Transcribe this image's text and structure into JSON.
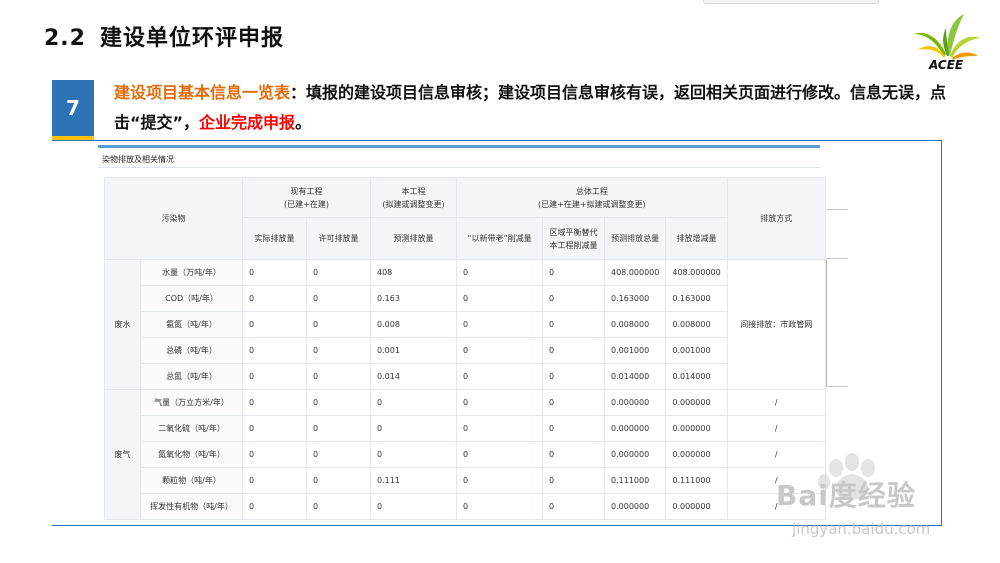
{
  "slide": {
    "section_number": "2.2",
    "title": "建设单位环评申报",
    "logo_text": "ACEE",
    "step_number": "7",
    "desc": {
      "part1": "建设项目基本信息一览表",
      "part2": "：填报的建设项目信息审核；建设项目信息审核有误，返回相关页面进行修改。信息无误，点击“提交”，",
      "part3": "企业完成申报",
      "part4": "。"
    }
  },
  "screenshot": {
    "subtitle": "染物排放及相关情况",
    "headers": {
      "pollutant": "污染物",
      "existing": "现有工程",
      "existing_sub": "(已建+在建)",
      "current": "本工程",
      "current_sub": "(拟建或调整变更)",
      "total": "总体工程",
      "total_sub": "(已建+在建+拟建或调整变更)",
      "method": "排放方式",
      "actual": "实际排放量",
      "permitted": "许可排放量",
      "predicted": "预测排放量",
      "old_for_new": "“以新带老”削减量",
      "region_line1": "区域平衡替代",
      "region_line2": "本工程削减量",
      "total_predicted": "预测排放总量",
      "change": "排放增减量"
    },
    "groups": [
      {
        "label": "废水",
        "method": "间接排放：市政管网",
        "rows": [
          {
            "name": "水量（万吨/年）",
            "values": [
              "0",
              "0",
              "408",
              "0",
              "0",
              "408.000000",
              "408.000000"
            ]
          },
          {
            "name": "COD（吨/年）",
            "values": [
              "0",
              "0",
              "0.163",
              "0",
              "0",
              "0.163000",
              "0.163000"
            ]
          },
          {
            "name": "氨氮（吨/年）",
            "values": [
              "0",
              "0",
              "0.008",
              "0",
              "0",
              "0.008000",
              "0.008000"
            ]
          },
          {
            "name": "总磷（吨/年）",
            "values": [
              "0",
              "0",
              "0.001",
              "0",
              "0",
              "0.001000",
              "0.001000"
            ]
          },
          {
            "name": "总氮（吨/年）",
            "values": [
              "0",
              "0",
              "0.014",
              "0",
              "0",
              "0.014000",
              "0.014000"
            ]
          }
        ]
      },
      {
        "label": "废气",
        "rows": [
          {
            "name": "气量（万立方米/年）",
            "values": [
              "0",
              "0",
              "0",
              "0",
              "0",
              "0.000000",
              "0.000000"
            ],
            "method": "/"
          },
          {
            "name": "二氧化硫（吨/年）",
            "values": [
              "0",
              "0",
              "0",
              "0",
              "0",
              "0.000000",
              "0.000000"
            ],
            "method": "/"
          },
          {
            "name": "氮氧化物（吨/年）",
            "values": [
              "0",
              "0",
              "0",
              "0",
              "0",
              "0.000000",
              "0.000000"
            ],
            "method": "/"
          },
          {
            "name": "颗粒物（吨/年）",
            "values": [
              "0",
              "0",
              "0.111",
              "0",
              "0",
              "0.111000",
              "0.111000"
            ],
            "method": "/"
          },
          {
            "name": "挥发性有机物（吨/年）",
            "values": [
              "0",
              "0",
              "0",
              "0",
              "0",
              "0.000000",
              "0.000000"
            ],
            "method": "/"
          }
        ]
      }
    ]
  },
  "watermark": {
    "brand": "Bai度经验",
    "url": "jingyan.baidu.com"
  },
  "colors": {
    "accent_blue": "#2e74b5",
    "accent_yellow": "#ffc000",
    "highlight_orange": "#e36c09",
    "highlight_red": "#ff0000"
  }
}
